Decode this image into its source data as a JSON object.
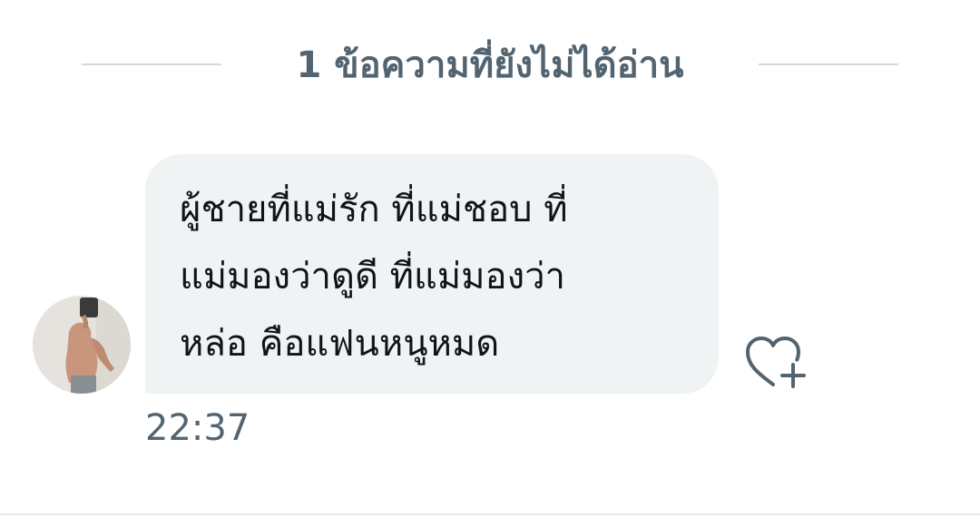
{
  "unread_divider": {
    "label": "1 ข้อความที่ยังไม่ได้อ่าน"
  },
  "message": {
    "text": "ผู้ชายที่แม่รัก ที่แม่ชอบ ที่\nแม่มองว่าดูดี ที่แม่มองว่า\nหล่อ คือแฟนหนูหมด",
    "time": "22:37"
  },
  "icons": {
    "react": "heart-plus-icon",
    "avatar": "profile-photo"
  },
  "colors": {
    "bubble_bg": "#eff3f4",
    "text_primary": "#0f1419",
    "text_secondary": "#536471",
    "divider": "#cfd9de"
  }
}
